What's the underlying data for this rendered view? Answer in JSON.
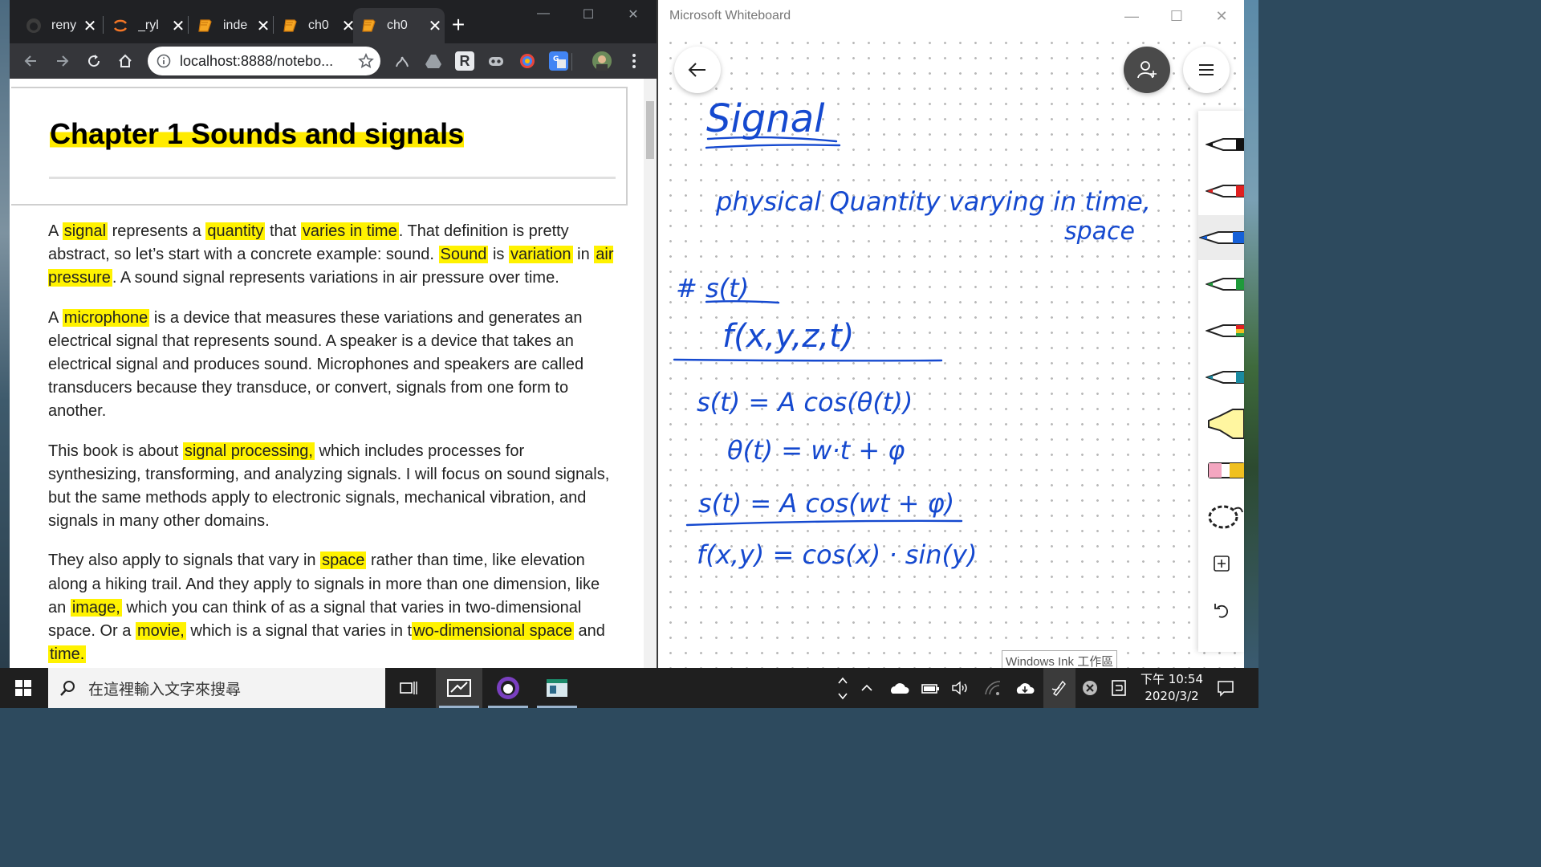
{
  "chrome": {
    "tabs": [
      {
        "title": "reny",
        "icon": "github-icon"
      },
      {
        "title": "_ryl",
        "icon": "jupyter-icon"
      },
      {
        "title": "inde",
        "icon": "book-icon"
      },
      {
        "title": "ch0",
        "icon": "book-icon"
      },
      {
        "title": "ch0",
        "icon": "book-icon",
        "active": true
      }
    ],
    "new_tab_label": "+",
    "url": "localhost:8888/notebo...",
    "extension_r_label": "R"
  },
  "notebook": {
    "title": "Chapter 1 Sounds and signals",
    "p1": {
      "t1": "A ",
      "h1": "signal",
      "t2": " represents a ",
      "h2": "quantity",
      "t3": " that ",
      "h3": "varies in time",
      "t4": ". That definition is pretty abstract, so let’s start with a concrete example: sound. ",
      "h4": "Sound",
      "t5": " is ",
      "h5": "variation",
      "t6": " in ",
      "h6": "air pressure",
      "t7": ". A sound signal represents variations in air pressure over time."
    },
    "p2": {
      "t1": "A ",
      "h1": "microphone",
      "t2": " is a device that measures these variations and generates an electrical signal that represents sound. A speaker is a device that takes an electrical signal and produces sound. Microphones and speakers are called transducers because they transduce, or convert, signals from one form to another."
    },
    "p3": {
      "t1": "This book is about ",
      "h1": "signal processing,",
      "t2": " which includes processes for synthesizing, transforming, and analyzing signals. I will focus on sound signals, but the same methods apply to electronic signals, mechanical vibration, and signals in many other domains."
    },
    "p4": {
      "t1": "They also apply to signals that vary in ",
      "h1": "space",
      "t2": " rather than time, like elevation along a hiking trail. And they apply to signals in more than one dimension, like an ",
      "h2": "image,",
      "t3": " which you can think of as a signal that varies in two-dimensional space. Or a ",
      "h3": "movie,",
      "t4": " which is a signal that varies in t",
      "h4": "wo-dimensional space",
      "t5": " and ",
      "h5": "time."
    }
  },
  "whiteboard": {
    "app_title": "Microsoft Whiteboard",
    "ink_badge": "Windows Ink 工作區",
    "ink": {
      "line1": "Signal",
      "line2": "physical Quantity varying in time,",
      "line3": "space",
      "line4": "# s(t)",
      "line5": "f(x,y,z,t)",
      "line6": "s(t) =  A cos(θ(t))",
      "line7": "θ(t) = w·t + φ",
      "line8": "s(t) = A cos(wt + φ)",
      "line9": "f(x,y) =  cos(x) · sin(y)"
    },
    "ink_color": "#1549cf"
  },
  "taskbar": {
    "search_placeholder": "在這裡輸入文字來搜尋",
    "time": "下午 10:54",
    "date": "2020/3/2"
  },
  "colors": {
    "highlight": "#fff200",
    "chrome_dark": "#202124",
    "taskbar": "#1f1f1f"
  }
}
